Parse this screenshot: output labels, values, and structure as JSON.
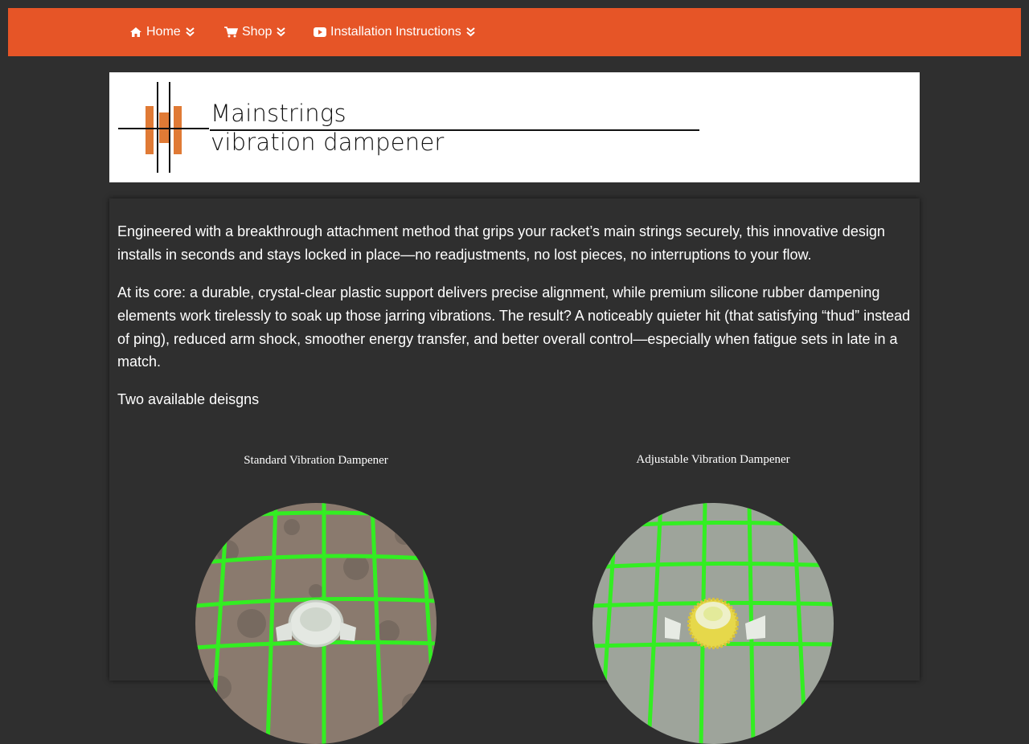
{
  "nav": {
    "items": [
      {
        "label": "Home",
        "icon": "home-icon"
      },
      {
        "label": "Shop",
        "icon": "cart-icon"
      },
      {
        "label": "Installation Instructions",
        "icon": "youtube-icon"
      }
    ],
    "bg_color": "#e65527"
  },
  "logo": {
    "line1": "Mainstrings",
    "line2": "vibration dampener",
    "accent_color": "#e07a35"
  },
  "content": {
    "paragraphs": [
      "Engineered with a breakthrough attachment method that grips your racket’s main strings securely, this innovative design installs in seconds and stays locked in place—no readjustments, no lost pieces, no interruptions to your flow.",
      "At its core: a durable, crystal-clear plastic support delivers precise alignment, while premium silicone rubber dampening elements work tirelessly to soak up those jarring vibrations. The result? A noticeably quieter hit (that satisfying “thud” instead of ping), reduced arm shock, smoother energy transfer, and better overall control—especially when fatigue sets in late in a match.",
      "Two available deisgns"
    ],
    "products": [
      {
        "title": "Standard Vibration Dampener"
      },
      {
        "title": "Adjustable Vibration Dampener"
      }
    ]
  },
  "colors": {
    "page_bg": "#2f2f2f",
    "string_green": "#33ee22"
  }
}
